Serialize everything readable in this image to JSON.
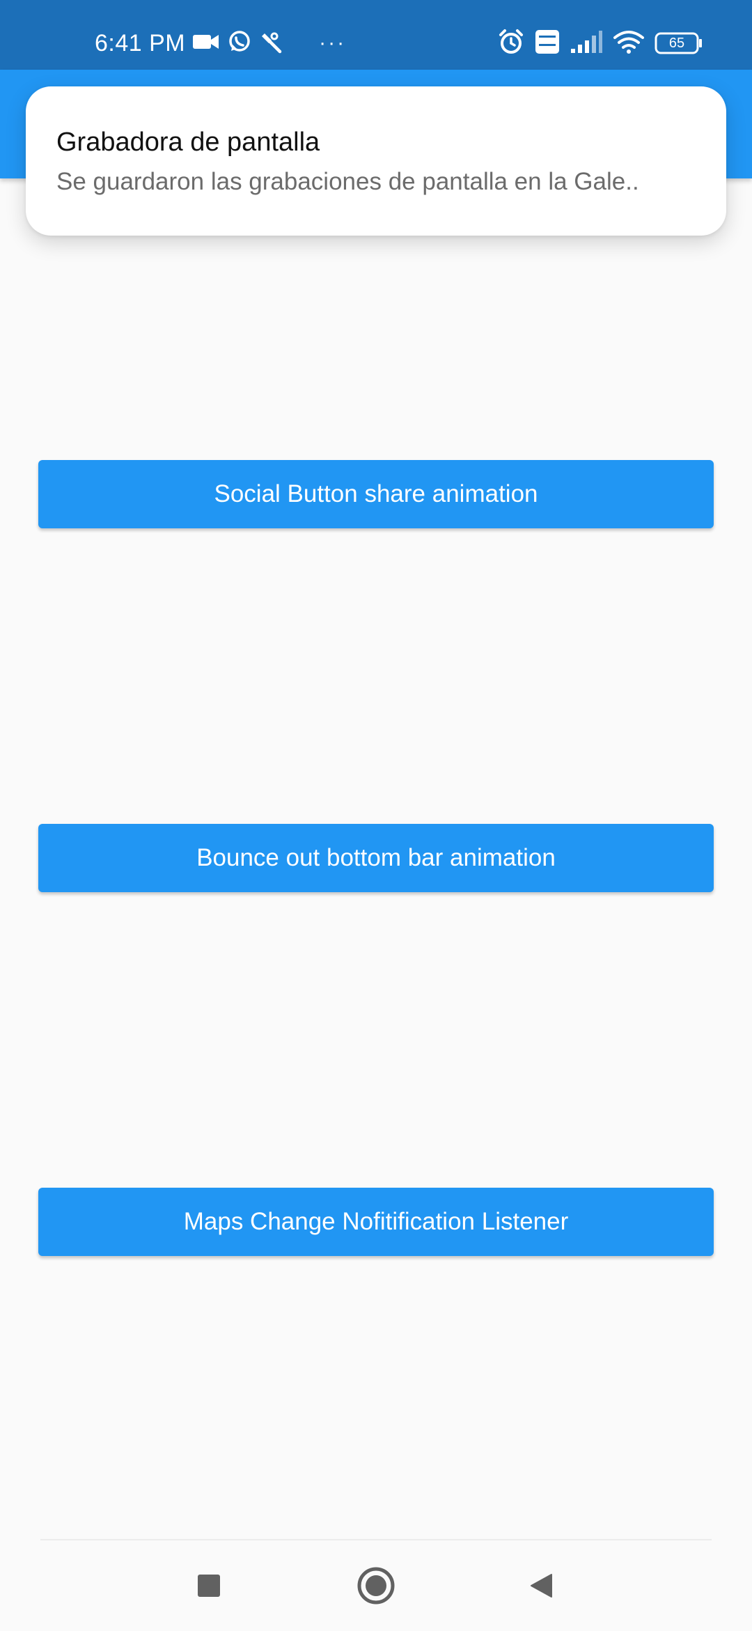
{
  "status_bar": {
    "time": "6:41 PM",
    "more_indicator": "···",
    "battery_level": "65",
    "icons": [
      "video-camera-icon",
      "whatsapp-icon",
      "tools-icon",
      "alarm-icon",
      "volte-icon",
      "signal-icon",
      "wifi-icon",
      "battery-icon"
    ]
  },
  "notification": {
    "title": "Grabadora de pantalla",
    "body": "Se guardaron las grabaciones de pantalla en la Gale.."
  },
  "buttons": {
    "social_share": "Social Button share animation",
    "bounce_out": "Bounce out bottom bar animation",
    "maps_listener": "Maps Change Nofitification Listener"
  },
  "nav_bar": {
    "icons": [
      "recents-square-icon",
      "home-circle-icon",
      "back-triangle-icon"
    ]
  },
  "colors": {
    "status_bar": "#1c6fb8",
    "app_bar": "#2196f3",
    "button": "#2196f3",
    "background": "#fafafa"
  }
}
